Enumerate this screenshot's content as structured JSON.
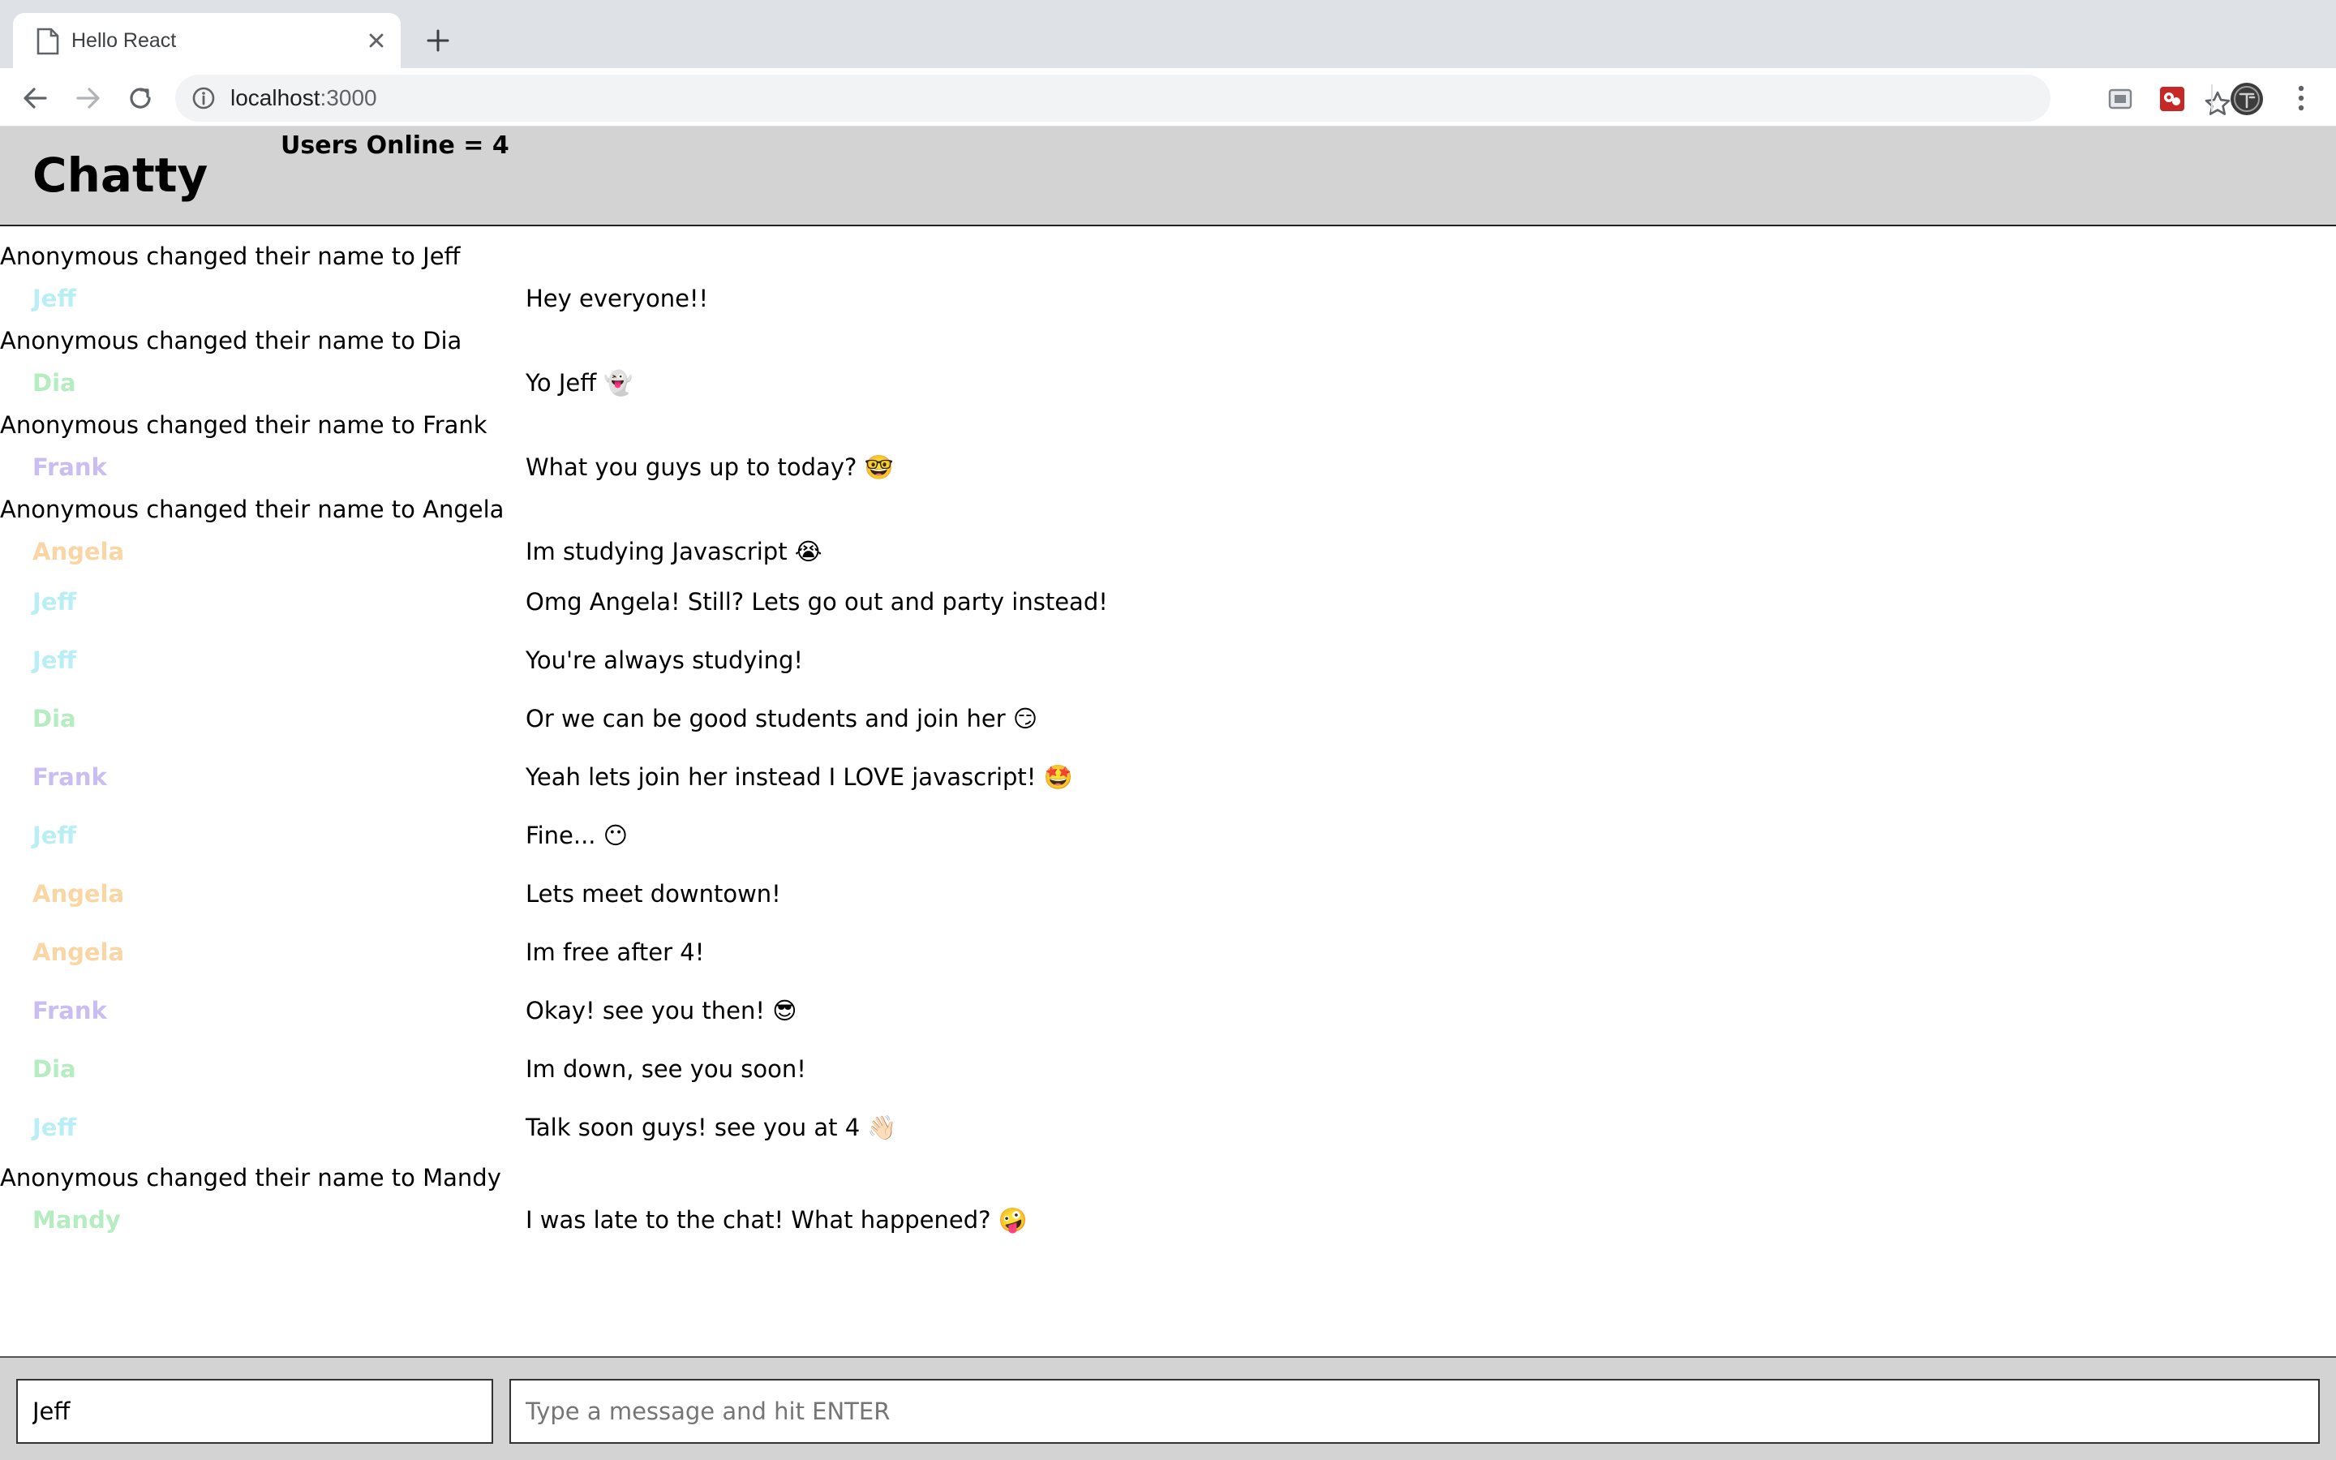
{
  "browser": {
    "tab": {
      "title": "Hello React",
      "page_icon": "page-icon",
      "close_icon": "close-icon"
    },
    "new_tab_icon": "plus-icon",
    "toolbar": {
      "back_icon": "back-arrow-icon",
      "forward_icon": "forward-arrow-icon",
      "reload_icon": "reload-icon",
      "info_icon": "info-icon",
      "url_host": "localhost",
      "url_port": ":3000",
      "bookmark_icon": "star-icon",
      "extension_icons": [
        "screen-extension-icon",
        "red-extension-icon"
      ],
      "profile_icon": "profile-avatar-icon",
      "menu_icon": "kebab-menu-icon"
    }
  },
  "header": {
    "brand": "Chatty",
    "users_online": "Users Online = 4"
  },
  "colors": {
    "Jeff": "#b9eef4",
    "Dia": "#b5ecc0",
    "Frank": "#c9bdf2",
    "Angela": "#fad6a5",
    "Mandy": "#b5ecc0",
    "header_bg": "#d3d3d3"
  },
  "messages": [
    {
      "type": "system",
      "text": "Anonymous changed their name to Jeff"
    },
    {
      "type": "message",
      "user": "Jeff",
      "content": "Hey everyone!!"
    },
    {
      "type": "system",
      "text": "Anonymous changed their name to Dia"
    },
    {
      "type": "message",
      "user": "Dia",
      "content": "Yo Jeff 👻"
    },
    {
      "type": "system",
      "text": "Anonymous changed their name to Frank"
    },
    {
      "type": "message",
      "user": "Frank",
      "content": "What you guys up to today? 🤓"
    },
    {
      "type": "system",
      "text": "Anonymous changed their name to Angela"
    },
    {
      "type": "message",
      "user": "Angela",
      "content": "Im studying Javascript 😭"
    },
    {
      "type": "message",
      "user": "Jeff",
      "content": "Omg Angela! Still? Lets go out and party instead!"
    },
    {
      "type": "message",
      "user": "Jeff",
      "content": "You're always studying!"
    },
    {
      "type": "message",
      "user": "Dia",
      "content": "Or we can be good students and join her 😏"
    },
    {
      "type": "message",
      "user": "Frank",
      "content": "Yeah lets join her instead I LOVE javascript! 🤩"
    },
    {
      "type": "message",
      "user": "Jeff",
      "content": "Fine... 😶"
    },
    {
      "type": "message",
      "user": "Angela",
      "content": "Lets meet downtown!"
    },
    {
      "type": "message",
      "user": "Angela",
      "content": "Im free after 4!"
    },
    {
      "type": "message",
      "user": "Frank",
      "content": "Okay! see you then! 😎"
    },
    {
      "type": "message",
      "user": "Dia",
      "content": "Im down, see you soon!"
    },
    {
      "type": "message",
      "user": "Jeff",
      "content": "Talk soon guys! see you at 4 👋🏻"
    },
    {
      "type": "system",
      "text": "Anonymous changed their name to Mandy"
    },
    {
      "type": "message",
      "user": "Mandy",
      "content": "I was late to the chat! What happened? 🤪"
    }
  ],
  "chatbar": {
    "username_value": "Jeff",
    "message_placeholder": "Type a message and hit ENTER"
  }
}
